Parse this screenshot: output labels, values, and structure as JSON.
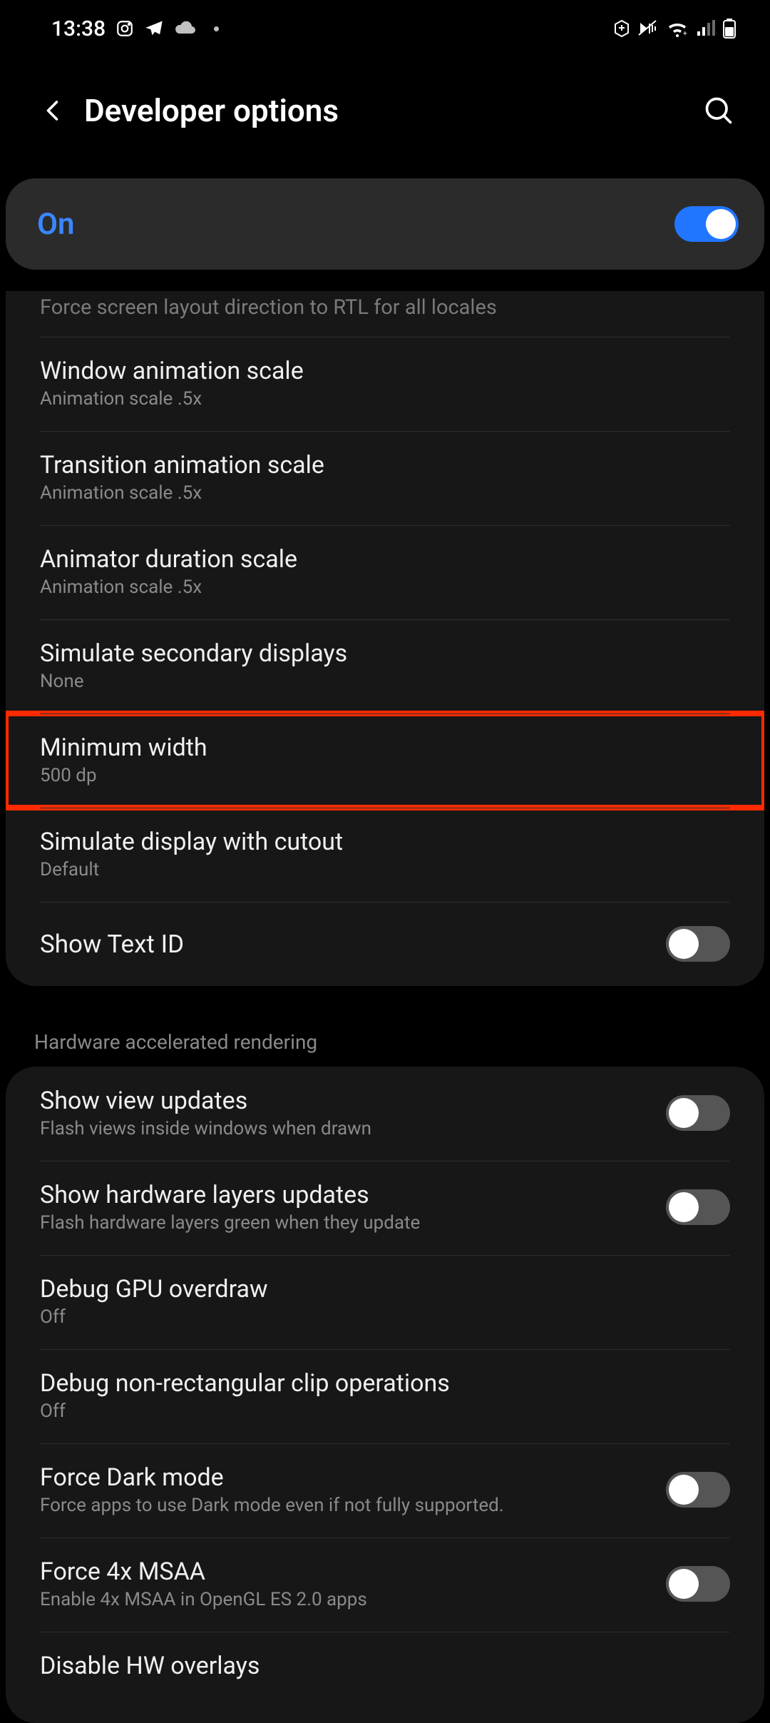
{
  "status": {
    "time": "13:38"
  },
  "header": {
    "title": "Developer options"
  },
  "master": {
    "label": "On",
    "state": true
  },
  "partial": {
    "text": "Force screen layout direction to RTL for all locales"
  },
  "group1": [
    {
      "title": "Window animation scale",
      "sub": "Animation scale .5x",
      "toggle": null
    },
    {
      "title": "Transition animation scale",
      "sub": "Animation scale .5x",
      "toggle": null
    },
    {
      "title": "Animator duration scale",
      "sub": "Animation scale .5x",
      "toggle": null
    },
    {
      "title": "Simulate secondary displays",
      "sub": "None",
      "toggle": null
    },
    {
      "title": "Minimum width",
      "sub": "500 dp",
      "toggle": null,
      "highlight": true
    },
    {
      "title": "Simulate display with cutout",
      "sub": "Default",
      "toggle": null
    },
    {
      "title": "Show Text ID",
      "sub": "",
      "toggle": false
    }
  ],
  "section2_header": "Hardware accelerated rendering",
  "group2": [
    {
      "title": "Show view updates",
      "sub": "Flash views inside windows when drawn",
      "toggle": false
    },
    {
      "title": "Show hardware layers updates",
      "sub": "Flash hardware layers green when they update",
      "toggle": false
    },
    {
      "title": "Debug GPU overdraw",
      "sub": "Off",
      "toggle": null
    },
    {
      "title": "Debug non-rectangular clip operations",
      "sub": "Off",
      "toggle": null
    },
    {
      "title": "Force Dark mode",
      "sub": "Force apps to use Dark mode even if not fully supported.",
      "toggle": false
    },
    {
      "title": "Force 4x MSAA",
      "sub": "Enable 4x MSAA in OpenGL ES 2.0 apps",
      "toggle": false
    },
    {
      "title": "Disable HW overlays",
      "sub": "",
      "toggle": null
    }
  ]
}
